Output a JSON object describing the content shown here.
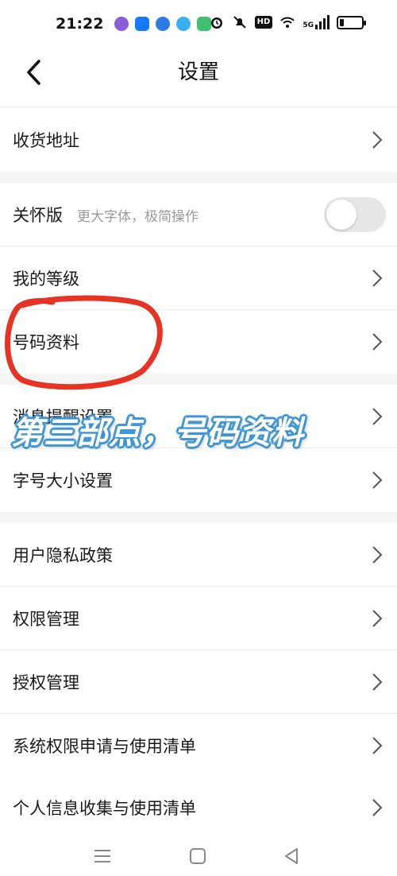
{
  "status_bar": {
    "time": "21:22",
    "badges": {
      "hd": "HD",
      "network": "5G"
    },
    "battery_level": 0.2,
    "app_icons": [
      "messages-icon",
      "alipay-icon",
      "browser-icon",
      "qq-browser-icon",
      "map-icon"
    ]
  },
  "header": {
    "title": "设置",
    "back_icon": "chevron-left-icon"
  },
  "rows": [
    {
      "label": "收货地址"
    },
    {
      "label": "关怀版",
      "sub": "更大字体，极简操作",
      "toggle_on": false
    },
    {
      "label": "我的等级"
    },
    {
      "label": "号码资料"
    },
    {
      "label": "消息提醒设置"
    },
    {
      "label": "字号大小设置"
    },
    {
      "label": "用户隐私政策"
    },
    {
      "label": "权限管理"
    },
    {
      "label": "授权管理"
    },
    {
      "label": "系统权限申请与使用清单"
    },
    {
      "label": "个人信息收集与使用清单"
    }
  ],
  "annotation": {
    "text": "第三部点，号码资料",
    "circle_color": "#e63324",
    "text_outline_color": "#3f95d6"
  },
  "system_nav": [
    "menu-icon",
    "home-icon",
    "back-icon"
  ]
}
